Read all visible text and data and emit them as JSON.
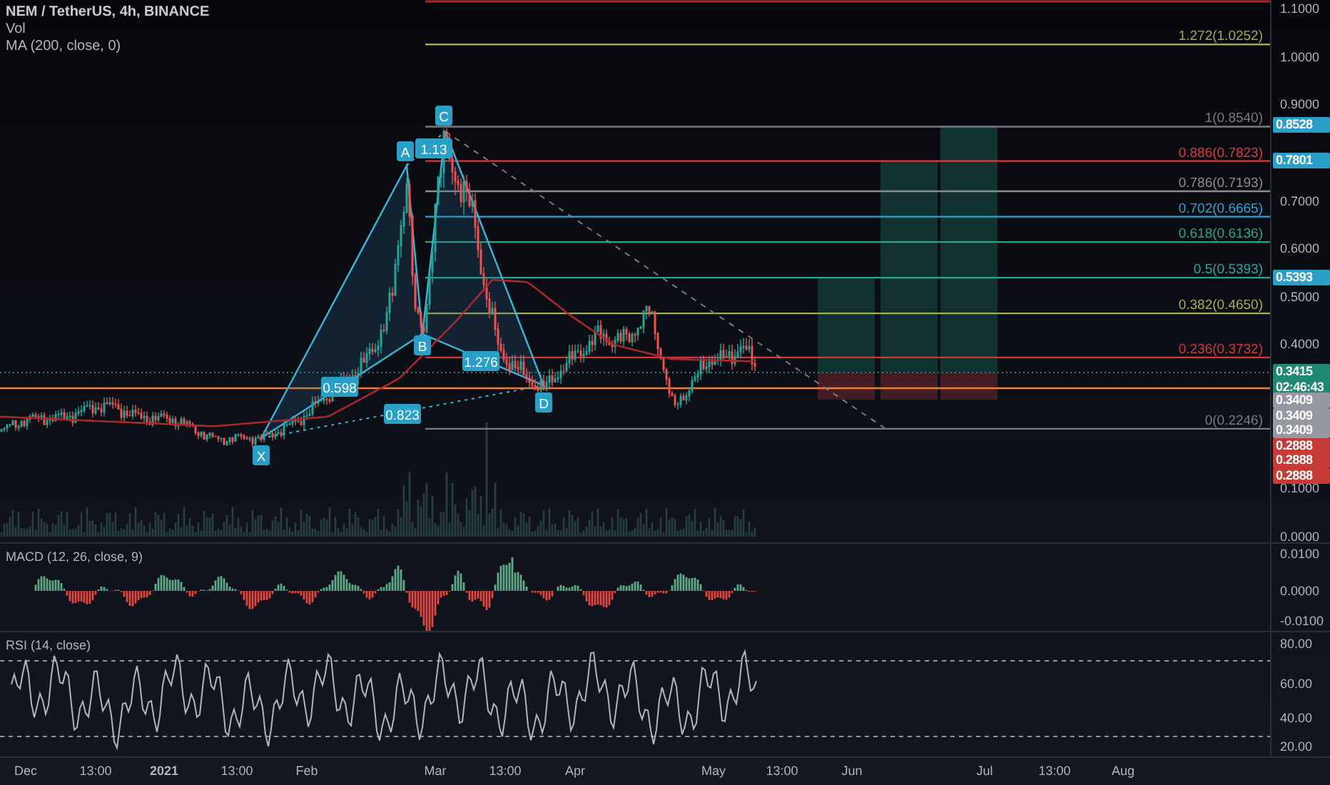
{
  "header": {
    "symbol_title": "NEM / TetherUS, 4h, BINANCE",
    "indicators": [
      "Vol",
      "MA (200, close, 0)"
    ]
  },
  "fib_levels": [
    {
      "label": "1.272(1.0252)",
      "color": "#9bab4e"
    },
    {
      "label": "1(0.8540)",
      "color": "#787b86"
    },
    {
      "label": "0.886(0.7823)",
      "color": "#e0373c"
    },
    {
      "label": "0.786(0.7193)",
      "color": "#8a8d96"
    },
    {
      "label": "0.702(0.6665)",
      "color": "#29a6d6"
    },
    {
      "label": "0.618(0.6136)",
      "color": "#2aa57a"
    },
    {
      "label": "0.5(0.5393)",
      "color": "#26a69a"
    },
    {
      "label": "0.382(0.4650)",
      "color": "#a4ad50"
    },
    {
      "label": "0.236(0.3732)",
      "color": "#d8323a"
    },
    {
      "label": "0(0.2246)",
      "color": "#787b86"
    }
  ],
  "pattern_points": [
    "X",
    "A",
    "B",
    "C",
    "D"
  ],
  "pattern_ratios": [
    "0.598",
    "1.13",
    "1.276",
    "0.823"
  ],
  "price_axis": {
    "ticks": [
      "1.1000",
      "1.0000",
      "0.9000",
      "0.7000",
      "0.6000",
      "0.5000",
      "0.4000",
      "0.1000",
      "0.0000"
    ],
    "badges": [
      {
        "text": "0.8528",
        "color": "#2a9fc7"
      },
      {
        "text": "0.7801",
        "color": "#2a9fc7"
      },
      {
        "text": "0.5393",
        "color": "#2a9fc7"
      },
      {
        "text": "0.3415",
        "countdown": "02:46:43",
        "color": "#1e8a73"
      },
      {
        "text": "0.3409",
        "color": "#9598a1"
      },
      {
        "text": "0.3409",
        "color": "#9598a1"
      },
      {
        "text": "0.3409",
        "color": "#9598a1"
      },
      {
        "text": "0.2888",
        "color": "#c83a36"
      },
      {
        "text": "0.2888",
        "color": "#c83a36"
      },
      {
        "text": "0.2888",
        "color": "#c83a36"
      }
    ]
  },
  "macd": {
    "title": "MACD (12, 26, close, 9)",
    "ticks": [
      "0.0100",
      "0.0000",
      "-0.0100"
    ]
  },
  "rsi": {
    "title": "RSI (14, close)",
    "ticks": [
      "80.00",
      "60.00",
      "40.00",
      "20.00"
    ]
  },
  "time_axis": [
    "Dec",
    "13:00",
    "2021",
    "13:00",
    "Feb",
    "Mar",
    "13:00",
    "Apr",
    "May",
    "13:00",
    "Jun",
    "Jul",
    "13:00",
    "Aug"
  ]
}
